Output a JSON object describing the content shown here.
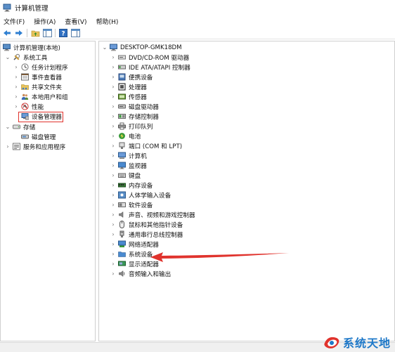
{
  "window": {
    "title": "计算机管理"
  },
  "menu": [
    "文件(F)",
    "操作(A)",
    "查看(V)",
    "帮助(H)"
  ],
  "left_tree": {
    "root": "计算机管理(本地)",
    "system_tools": "系统工具",
    "system_tools_children": [
      "任务计划程序",
      "事件查看器",
      "共享文件夹",
      "本地用户和组",
      "性能",
      "设备管理器"
    ],
    "storage": "存储",
    "storage_children": [
      "磁盘管理"
    ],
    "services": "服务和应用程序"
  },
  "right_tree": {
    "root": "DESKTOP-GMK18DM",
    "categories": [
      "DVD/CD-ROM 驱动器",
      "IDE ATA/ATAPI 控制器",
      "便携设备",
      "处理器",
      "传感器",
      "磁盘驱动器",
      "存储控制器",
      "打印队列",
      "电池",
      "端口 (COM 和 LPT)",
      "计算机",
      "监视器",
      "键盘",
      "内存设备",
      "人体学输入设备",
      "软件设备",
      "声音、视频和游戏控制器",
      "鼠标和其他指针设备",
      "通用串行总线控制器",
      "网络适配器",
      "系统设备",
      "显示适配器",
      "音频输入和输出"
    ]
  },
  "watermark": {
    "text": "系统天地"
  },
  "colors": {
    "highlight_box": "#e0332d",
    "arrow": "#e0332d",
    "watermark": "#1e78c8"
  }
}
